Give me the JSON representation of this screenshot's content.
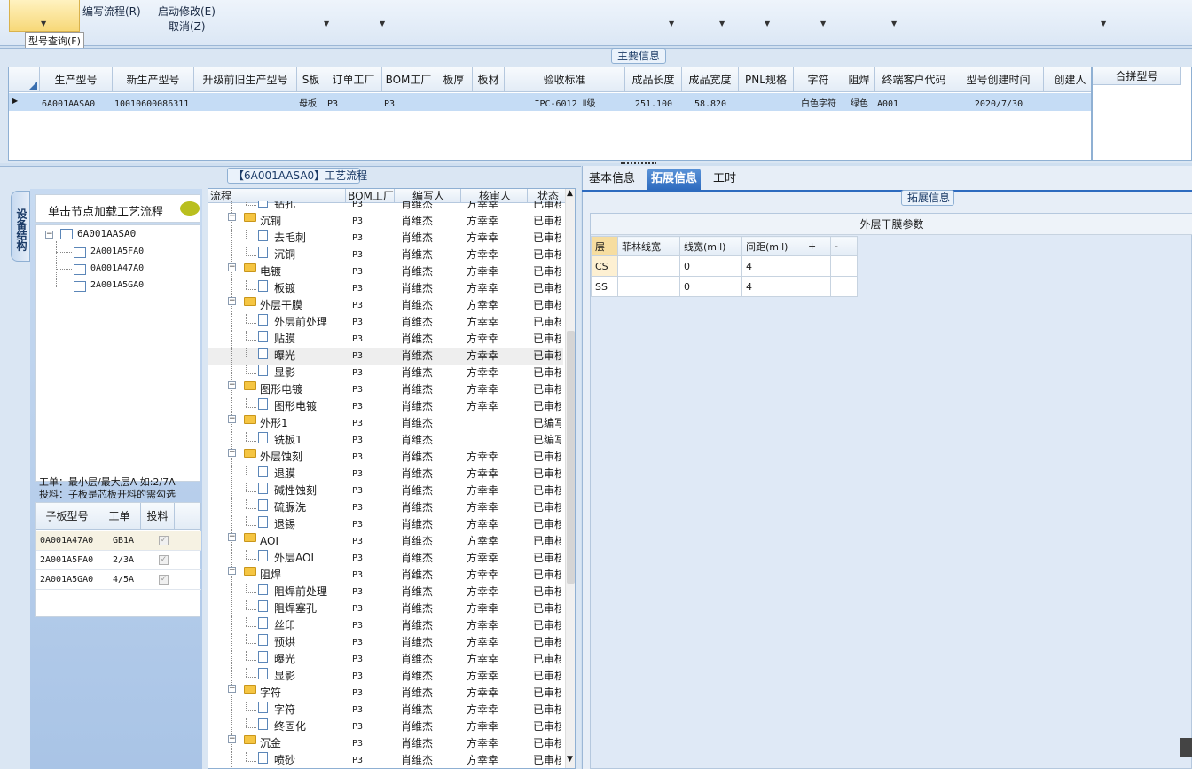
{
  "ribbon": {
    "active_button": "型号查询(F)",
    "buttons": [
      {
        "label": "编写流程(R)"
      },
      {
        "label": "启动修改(E)"
      },
      {
        "label": "取消(Z)"
      }
    ],
    "tooltip": "型号查询(F)"
  },
  "main_info": {
    "title": "主要信息",
    "columns": [
      "生产型号",
      "新生产型号",
      "升级前旧生产型号",
      "S板",
      "订单工厂",
      "BOM工厂",
      "板厚",
      "板材",
      "验收标准",
      "成品长度",
      "成品宽度",
      "PNL规格",
      "字符",
      "阻焊",
      "终端客户代码",
      "型号创建时间",
      "创建人"
    ],
    "row": {
      "生产型号": "6A001AASA0",
      "新生产型号": "10010600086311",
      "S板": "母板",
      "订单工厂": "P3",
      "BOM工厂": "P3",
      "验收标准": "IPC-6012 Ⅱ级",
      "成品长度": "251.100",
      "成品宽度": "58.820",
      "字符": "白色字符",
      "阻焊": "绿色",
      "终端客户代码": "A001",
      "型号创建时间": "2020/7/30"
    },
    "merge_header": "合拼型号"
  },
  "process": {
    "title": "【6A001AASA0】工艺流程",
    "side_tab": "设备结构",
    "load_hint": "单击节点加载工艺流程",
    "tree_root": "6A001AASA0",
    "tree_children": [
      "2A001A5FA0",
      "0A001A47A0",
      "2A001A5GA0"
    ],
    "note_line1": "工单：最小层/最大层A 如:2/7A",
    "note_line2": "投料：子板是芯板开料的需勾选",
    "sub_columns": [
      "子板型号",
      "工单",
      "投料"
    ],
    "sub_rows": [
      {
        "model": "0A001A47A0",
        "order": "GB1A"
      },
      {
        "model": "2A001A5FA0",
        "order": "2/3A"
      },
      {
        "model": "2A001A5GA0",
        "order": "4/5A"
      }
    ],
    "flow_columns": [
      "流程",
      "BOM工厂",
      "编写人",
      "核审人",
      "状态"
    ],
    "flow_rows": [
      {
        "level": 2,
        "type": "doc",
        "name": "钻孔",
        "bom": "P3",
        "writer": "肖维杰",
        "reviewer": "方幸幸",
        "status": "已审核"
      },
      {
        "level": 1,
        "type": "folder",
        "name": "沉铜",
        "bom": "P3",
        "writer": "肖维杰",
        "reviewer": "方幸幸",
        "status": "已审核"
      },
      {
        "level": 2,
        "type": "doc",
        "name": "去毛刺",
        "bom": "P3",
        "writer": "肖维杰",
        "reviewer": "方幸幸",
        "status": "已审核"
      },
      {
        "level": 2,
        "type": "doc",
        "name": "沉铜",
        "bom": "P3",
        "writer": "肖维杰",
        "reviewer": "方幸幸",
        "status": "已审核"
      },
      {
        "level": 1,
        "type": "folder",
        "name": "电镀",
        "bom": "P3",
        "writer": "肖维杰",
        "reviewer": "方幸幸",
        "status": "已审核"
      },
      {
        "level": 2,
        "type": "doc",
        "name": "板镀",
        "bom": "P3",
        "writer": "肖维杰",
        "reviewer": "方幸幸",
        "status": "已审核"
      },
      {
        "level": 1,
        "type": "folder",
        "name": "外层干膜",
        "bom": "P3",
        "writer": "肖维杰",
        "reviewer": "方幸幸",
        "status": "已审核"
      },
      {
        "level": 2,
        "type": "doc",
        "name": "外层前处理",
        "bom": "P3",
        "writer": "肖维杰",
        "reviewer": "方幸幸",
        "status": "已审核"
      },
      {
        "level": 2,
        "type": "doc",
        "name": "贴膜",
        "bom": "P3",
        "writer": "肖维杰",
        "reviewer": "方幸幸",
        "status": "已审核"
      },
      {
        "level": 2,
        "type": "doc",
        "name": "曝光",
        "bom": "P3",
        "writer": "肖维杰",
        "reviewer": "方幸幸",
        "status": "已审核",
        "sel": true
      },
      {
        "level": 2,
        "type": "doc",
        "name": "显影",
        "bom": "P3",
        "writer": "肖维杰",
        "reviewer": "方幸幸",
        "status": "已审核"
      },
      {
        "level": 1,
        "type": "folder",
        "name": "图形电镀",
        "bom": "P3",
        "writer": "肖维杰",
        "reviewer": "方幸幸",
        "status": "已审核"
      },
      {
        "level": 2,
        "type": "doc",
        "name": "图形电镀",
        "bom": "P3",
        "writer": "肖维杰",
        "reviewer": "方幸幸",
        "status": "已审核"
      },
      {
        "level": 1,
        "type": "folder",
        "name": "外形1",
        "bom": "P3",
        "writer": "肖维杰",
        "reviewer": "",
        "status": "已编写"
      },
      {
        "level": 2,
        "type": "doc",
        "name": "铣板1",
        "bom": "P3",
        "writer": "肖维杰",
        "reviewer": "",
        "status": "已编写"
      },
      {
        "level": 1,
        "type": "folder",
        "name": "外层蚀刻",
        "bom": "P3",
        "writer": "肖维杰",
        "reviewer": "方幸幸",
        "status": "已审核"
      },
      {
        "level": 2,
        "type": "doc",
        "name": "退膜",
        "bom": "P3",
        "writer": "肖维杰",
        "reviewer": "方幸幸",
        "status": "已审核"
      },
      {
        "level": 2,
        "type": "doc",
        "name": "碱性蚀刻",
        "bom": "P3",
        "writer": "肖维杰",
        "reviewer": "方幸幸",
        "status": "已审核"
      },
      {
        "level": 2,
        "type": "doc",
        "name": "硫脲洗",
        "bom": "P3",
        "writer": "肖维杰",
        "reviewer": "方幸幸",
        "status": "已审核"
      },
      {
        "level": 2,
        "type": "doc",
        "name": "退锡",
        "bom": "P3",
        "writer": "肖维杰",
        "reviewer": "方幸幸",
        "status": "已审核"
      },
      {
        "level": 1,
        "type": "folder",
        "name": "AOI",
        "bom": "P3",
        "writer": "肖维杰",
        "reviewer": "方幸幸",
        "status": "已审核"
      },
      {
        "level": 2,
        "type": "doc",
        "name": "外层AOI",
        "bom": "P3",
        "writer": "肖维杰",
        "reviewer": "方幸幸",
        "status": "已审核"
      },
      {
        "level": 1,
        "type": "folder",
        "name": "阻焊",
        "bom": "P3",
        "writer": "肖维杰",
        "reviewer": "方幸幸",
        "status": "已审核"
      },
      {
        "level": 2,
        "type": "doc",
        "name": "阻焊前处理",
        "bom": "P3",
        "writer": "肖维杰",
        "reviewer": "方幸幸",
        "status": "已审核"
      },
      {
        "level": 2,
        "type": "doc",
        "name": "阻焊塞孔",
        "bom": "P3",
        "writer": "肖维杰",
        "reviewer": "方幸幸",
        "status": "已审核"
      },
      {
        "level": 2,
        "type": "doc",
        "name": "丝印",
        "bom": "P3",
        "writer": "肖维杰",
        "reviewer": "方幸幸",
        "status": "已审核"
      },
      {
        "level": 2,
        "type": "doc",
        "name": "预烘",
        "bom": "P3",
        "writer": "肖维杰",
        "reviewer": "方幸幸",
        "status": "已审核"
      },
      {
        "level": 2,
        "type": "doc",
        "name": "曝光",
        "bom": "P3",
        "writer": "肖维杰",
        "reviewer": "方幸幸",
        "status": "已审核"
      },
      {
        "level": 2,
        "type": "doc",
        "name": "显影",
        "bom": "P3",
        "writer": "肖维杰",
        "reviewer": "方幸幸",
        "status": "已审核"
      },
      {
        "level": 1,
        "type": "folder",
        "name": "字符",
        "bom": "P3",
        "writer": "肖维杰",
        "reviewer": "方幸幸",
        "status": "已审核"
      },
      {
        "level": 2,
        "type": "doc",
        "name": "字符",
        "bom": "P3",
        "writer": "肖维杰",
        "reviewer": "方幸幸",
        "status": "已审核"
      },
      {
        "level": 2,
        "type": "doc",
        "name": "终固化",
        "bom": "P3",
        "writer": "肖维杰",
        "reviewer": "方幸幸",
        "status": "已审核"
      },
      {
        "level": 1,
        "type": "folder",
        "name": "沉金",
        "bom": "P3",
        "writer": "肖维杰",
        "reviewer": "方幸幸",
        "status": "已审核"
      },
      {
        "level": 2,
        "type": "doc",
        "name": "喷砂",
        "bom": "P3",
        "writer": "肖维杰",
        "reviewer": "方幸幸",
        "status": "已审核"
      }
    ]
  },
  "detail": {
    "tabs": [
      "基本信息",
      "拓展信息",
      "工时"
    ],
    "active_tab": "拓展信息",
    "section_title": "拓展信息",
    "table_title": "外层干膜参数",
    "columns": [
      "层",
      "菲林线宽",
      "线宽(mil)",
      "间距(mil)",
      "+",
      "-"
    ],
    "rows": [
      {
        "layer": "CS",
        "film": "",
        "width": "0",
        "spacing": "4"
      },
      {
        "layer": "SS",
        "film": "",
        "width": "0",
        "spacing": "4"
      }
    ]
  }
}
